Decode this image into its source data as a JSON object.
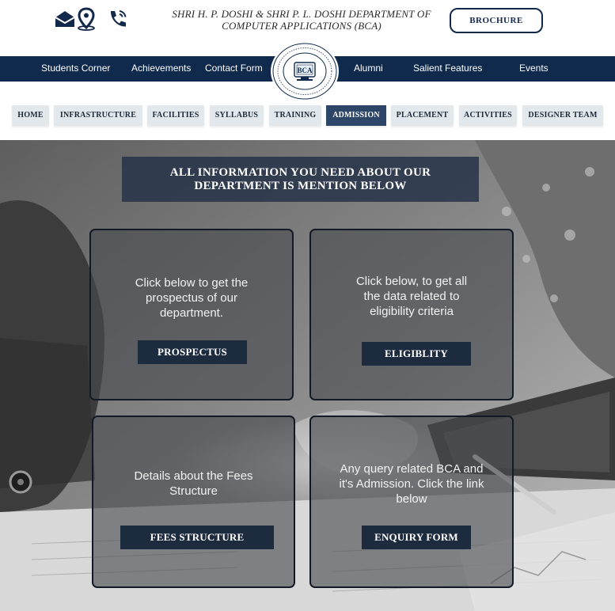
{
  "header": {
    "title_line1": "SHRI H. P. DOSHI & SHRI P. L. DOSHI  DEPARTMENT OF",
    "title_line2": "COMPUTER APPLICATIONS (BCA)",
    "brochure_label": "BROCHURE",
    "icons": [
      "mail-icon",
      "location-pin-icon",
      "phone-icon"
    ]
  },
  "logo": {
    "emblem_text": "BCA",
    "ring_text": "SHRI H. P. DOSHI & SHRI P. L. DOSHI DEPARTMENT OF COMPUTER APPLICATIONS"
  },
  "main_nav": {
    "items": [
      "Students Corner",
      "Achievements",
      "Contact Form",
      "Alumni",
      "Salient Features",
      "Events"
    ]
  },
  "sub_nav": {
    "items": [
      "HOME",
      "INFRASTRUCTURE",
      "FACILITIES",
      "SYLLABUS",
      "TRAINING",
      "ADMISSION",
      "PLACEMENT",
      "ACTIVITIES",
      "DESIGNER TEAM"
    ],
    "active": "ADMISSION"
  },
  "hero": {
    "banner_line1": "ALL INFORMATION YOU NEED ABOUT OUR",
    "banner_line2": "DEPARTMENT IS MENTION BELOW"
  },
  "cards": [
    {
      "text_lines": [
        "Click below to get the",
        "prospectus of our",
        "department."
      ],
      "button": "PROSPECTUS"
    },
    {
      "text_lines": [
        "Click below, to get all",
        "the data related to",
        "eligibility criteria"
      ],
      "button": "ELIGIBLITY"
    },
    {
      "text_lines": [
        "Details about the Fees",
        "Structure"
      ],
      "button": "FEES STRUCTURE"
    },
    {
      "text_lines": [
        "Any query related BCA and",
        "it's Admission. Click the link",
        "below"
      ],
      "button": "ENQUIRY FORM"
    }
  ],
  "colors": {
    "navy": "#0f2a4d",
    "active_pill": "#2d4566",
    "pill": "#e3e8ec",
    "card_button": "#1d2b3e"
  }
}
